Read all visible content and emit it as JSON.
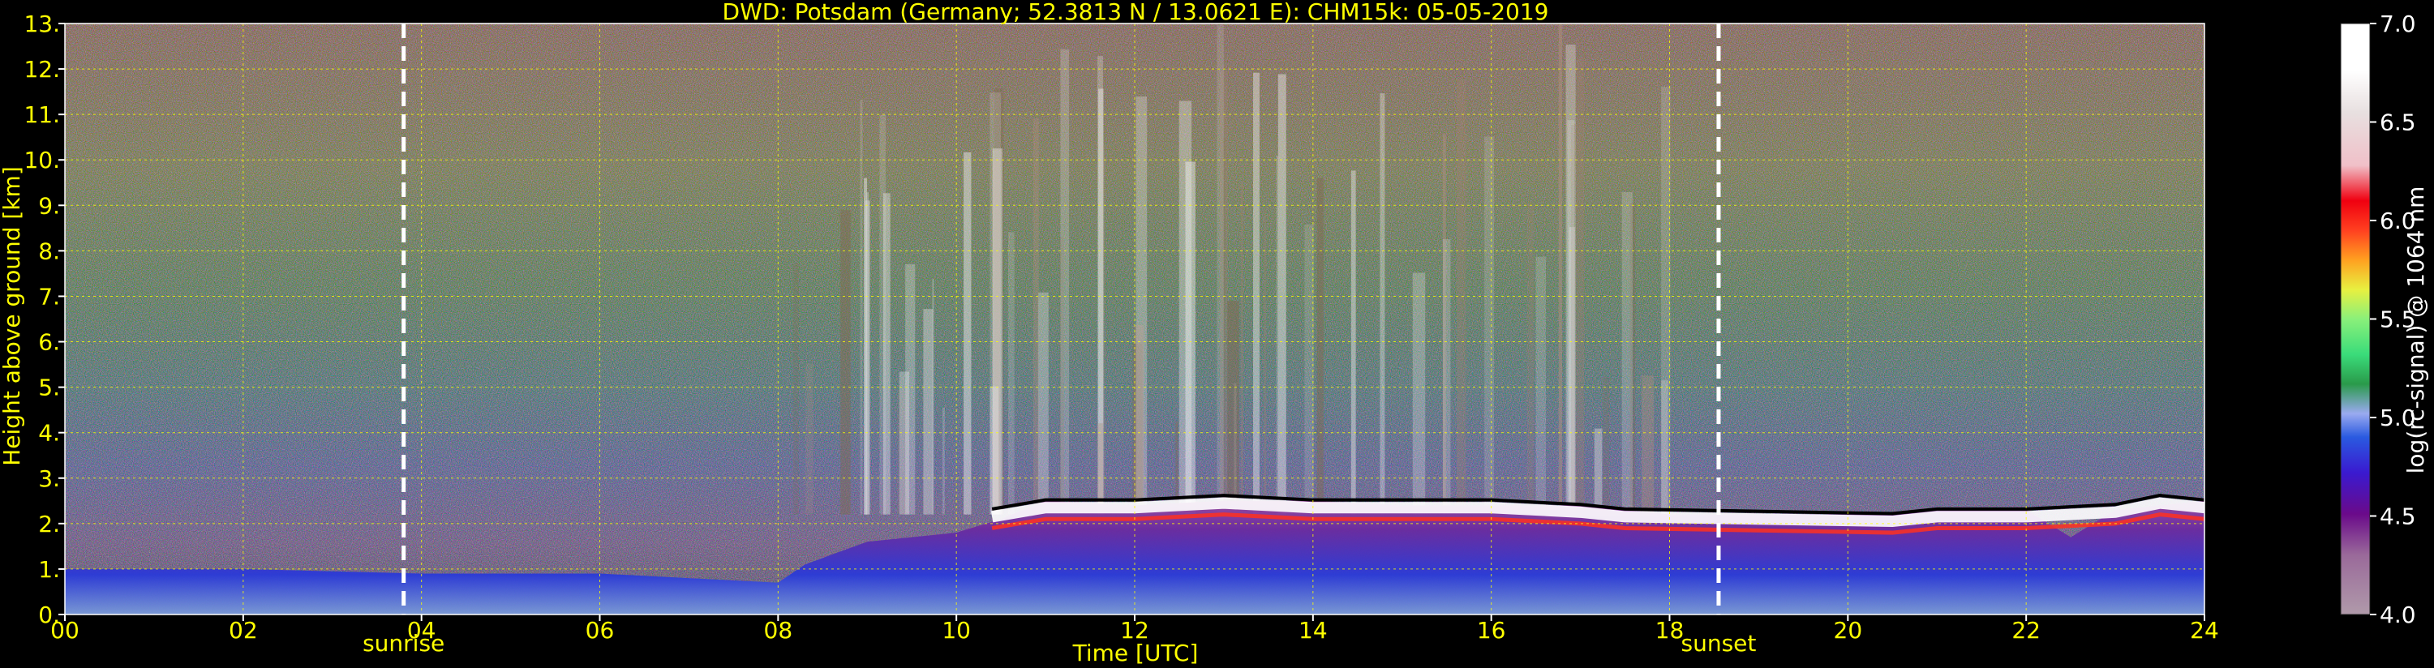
{
  "chart_data": {
    "type": "heatmap",
    "title": "DWD: Potsdam (Germany; 52.3813 N / 13.0621 E):    CHM15k: 05-05-2019",
    "xlabel": "Time [UTC]",
    "ylabel": "Height above ground [km]",
    "xlim": [
      0,
      24
    ],
    "ylim": [
      0,
      13
    ],
    "x_ticks": [
      0,
      2,
      4,
      6,
      8,
      10,
      12,
      14,
      16,
      18,
      20,
      22,
      24
    ],
    "x_tick_labels": [
      "00",
      "02",
      "04",
      "06",
      "08",
      "10",
      "12",
      "14",
      "16",
      "18",
      "20",
      "22",
      "24"
    ],
    "y_ticks": [
      0,
      1,
      2,
      3,
      4,
      5,
      6,
      7,
      8,
      9,
      10,
      11,
      12,
      13
    ],
    "y_tick_labels": [
      "0.",
      "1.",
      "2.",
      "3.",
      "4.",
      "5.",
      "6.",
      "7.",
      "8.",
      "9.",
      "10.",
      "11.",
      "12.",
      "13."
    ],
    "grid": true,
    "annotations": [
      {
        "label": "sunrise",
        "x": 3.8
      },
      {
        "label": "sunset",
        "x": 18.55
      }
    ],
    "colorbar": {
      "label": "log(rc-signal) @ 1064 nm",
      "range": [
        4.0,
        7.0
      ],
      "ticks": [
        4.0,
        4.5,
        5.0,
        5.5,
        6.0,
        6.5,
        7.0
      ],
      "tick_labels": [
        "4.0",
        "4.5",
        "5.0",
        "5.5",
        "6.0",
        "6.5",
        "7.0"
      ]
    },
    "layers": [
      {
        "name": "boundary layer top",
        "x": [
          0,
          2,
          4,
          6,
          8,
          8.3,
          9,
          10,
          10.5,
          11,
          12,
          13,
          14,
          15,
          16,
          17,
          17.5,
          18,
          19,
          20,
          21,
          22,
          22.5,
          23,
          24
        ],
        "y": [
          1.0,
          1.0,
          0.9,
          0.9,
          0.7,
          1.1,
          1.6,
          1.8,
          2.1,
          2.5,
          2.4,
          2.5,
          2.5,
          2.4,
          2.4,
          2.4,
          2.3,
          2.2,
          2.2,
          2.2,
          2.3,
          2.3,
          1.7,
          2.3,
          2.5
        ]
      },
      {
        "name": "cloud base",
        "x": [
          10.4,
          11,
          12,
          13,
          14,
          15,
          16,
          17,
          17.5,
          20.5,
          21,
          21.5,
          22,
          23,
          23.5,
          24
        ],
        "y": [
          2.3,
          2.5,
          2.5,
          2.6,
          2.5,
          2.5,
          2.5,
          2.4,
          2.3,
          2.2,
          2.3,
          2.3,
          2.3,
          2.4,
          2.6,
          2.5
        ]
      }
    ]
  }
}
